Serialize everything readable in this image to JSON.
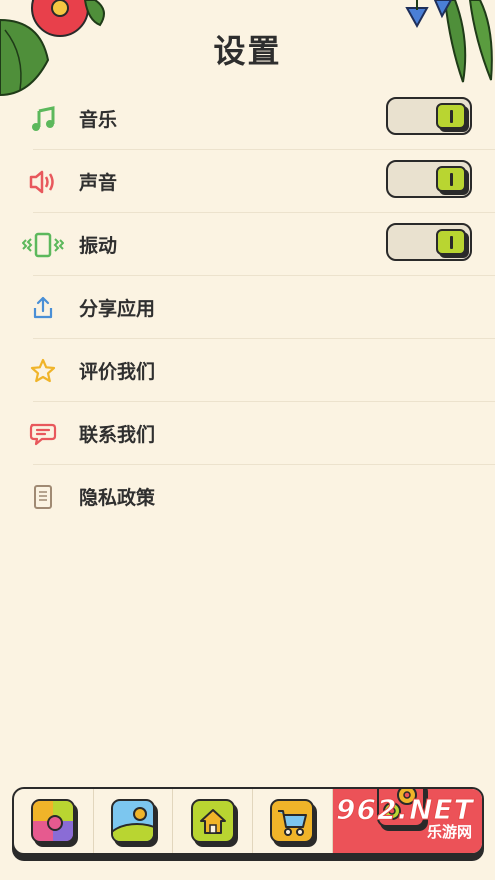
{
  "page": {
    "title": "设置"
  },
  "settings": [
    {
      "key": "music",
      "label": "音乐",
      "icon": "music-note-icon",
      "icon_color": "#5cb85c",
      "toggle": true,
      "on": true
    },
    {
      "key": "sound",
      "label": "声音",
      "icon": "speaker-icon",
      "icon_color": "#e8585c",
      "toggle": true,
      "on": true
    },
    {
      "key": "vibration",
      "label": "振动",
      "icon": "vibration-icon",
      "icon_color": "#5cb85c",
      "toggle": true,
      "on": true
    },
    {
      "key": "share",
      "label": "分享应用",
      "icon": "share-upload-icon",
      "icon_color": "#4a8fd6",
      "toggle": false
    },
    {
      "key": "rate",
      "label": "评价我们",
      "icon": "star-icon",
      "icon_color": "#f0b429",
      "toggle": false
    },
    {
      "key": "contact",
      "label": "联系我们",
      "icon": "chat-bubble-icon",
      "icon_color": "#e8585c",
      "toggle": false
    },
    {
      "key": "privacy",
      "label": "隐私政策",
      "icon": "document-icon",
      "icon_color": "#a08a73",
      "toggle": false
    }
  ],
  "tabs": [
    {
      "name": "puzzle",
      "icon": "puzzle-icon",
      "active": false
    },
    {
      "name": "gallery",
      "icon": "picture-icon",
      "active": false
    },
    {
      "name": "home",
      "icon": "home-icon",
      "active": false
    },
    {
      "name": "shop",
      "icon": "cart-icon",
      "active": false
    },
    {
      "name": "settings",
      "icon": "gears-icon",
      "active": true
    }
  ],
  "colors": {
    "background": "#fbf3e2",
    "toggle_knob": "#b9d531",
    "active_tab": "#ec5258"
  },
  "watermark": {
    "number": "962.NET",
    "text": "乐游网"
  }
}
